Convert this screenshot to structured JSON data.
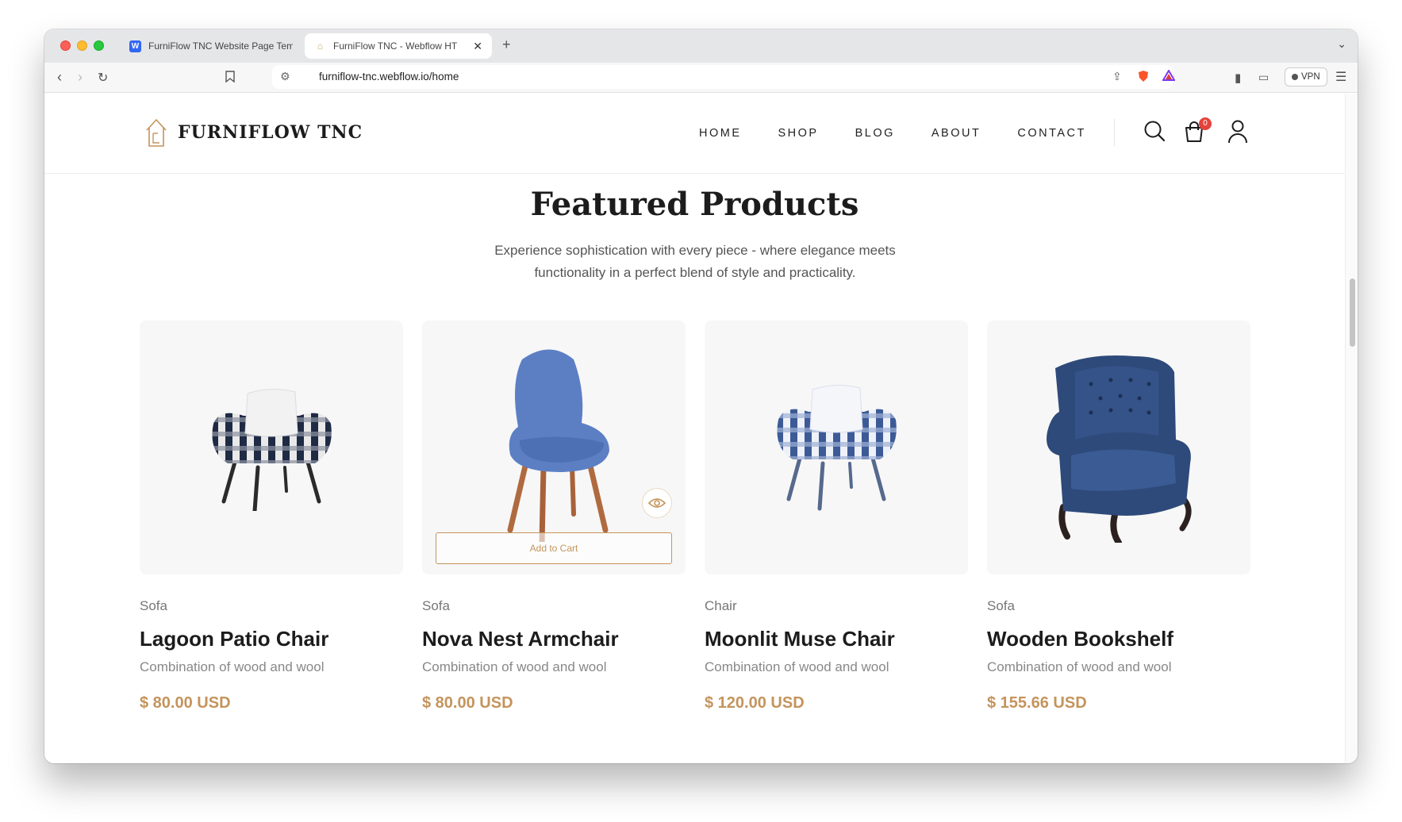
{
  "browser": {
    "tabs": [
      {
        "title": "FurniFlow TNC Website Page Tem",
        "favicon": "webflow-icon"
      },
      {
        "title": "FurniFlow TNC - Webflow HT",
        "favicon": "page-icon",
        "active": true
      }
    ],
    "url": "furniflow-tnc.webflow.io/home",
    "vpn_label": "VPN"
  },
  "site": {
    "logo_text": "FURNIFLOW TNC",
    "nav": [
      "HOME",
      "SHOP",
      "BLOG",
      "ABOUT",
      "CONTACT"
    ],
    "cart_count": "0",
    "accent_color": "#c4945c"
  },
  "section": {
    "title": "Featured Products",
    "subtitle": "Experience sophistication with every piece - where elegance meets functionality in a perfect blend of style and practicality."
  },
  "products": [
    {
      "category": "Sofa",
      "name": "Lagoon Patio Chair",
      "description": "Combination of wood and wool",
      "price": "$ 80.00 USD",
      "image": "plaid-armchair"
    },
    {
      "category": "Sofa",
      "name": "Nova Nest Armchair",
      "description": "Combination of wood and wool",
      "price": "$ 80.00 USD",
      "image": "blue-shell-chair",
      "add_to_cart": "Add to Cart"
    },
    {
      "category": "Chair",
      "name": "Moonlit Muse Chair",
      "description": "Combination of wood and wool",
      "price": "$ 120.00 USD",
      "image": "blue-plaid-armchair"
    },
    {
      "category": "Sofa",
      "name": "Wooden Bookshelf",
      "description": "Combination of wood and wool",
      "price": "$ 155.66 USD",
      "image": "velvet-wingback-chair"
    }
  ]
}
